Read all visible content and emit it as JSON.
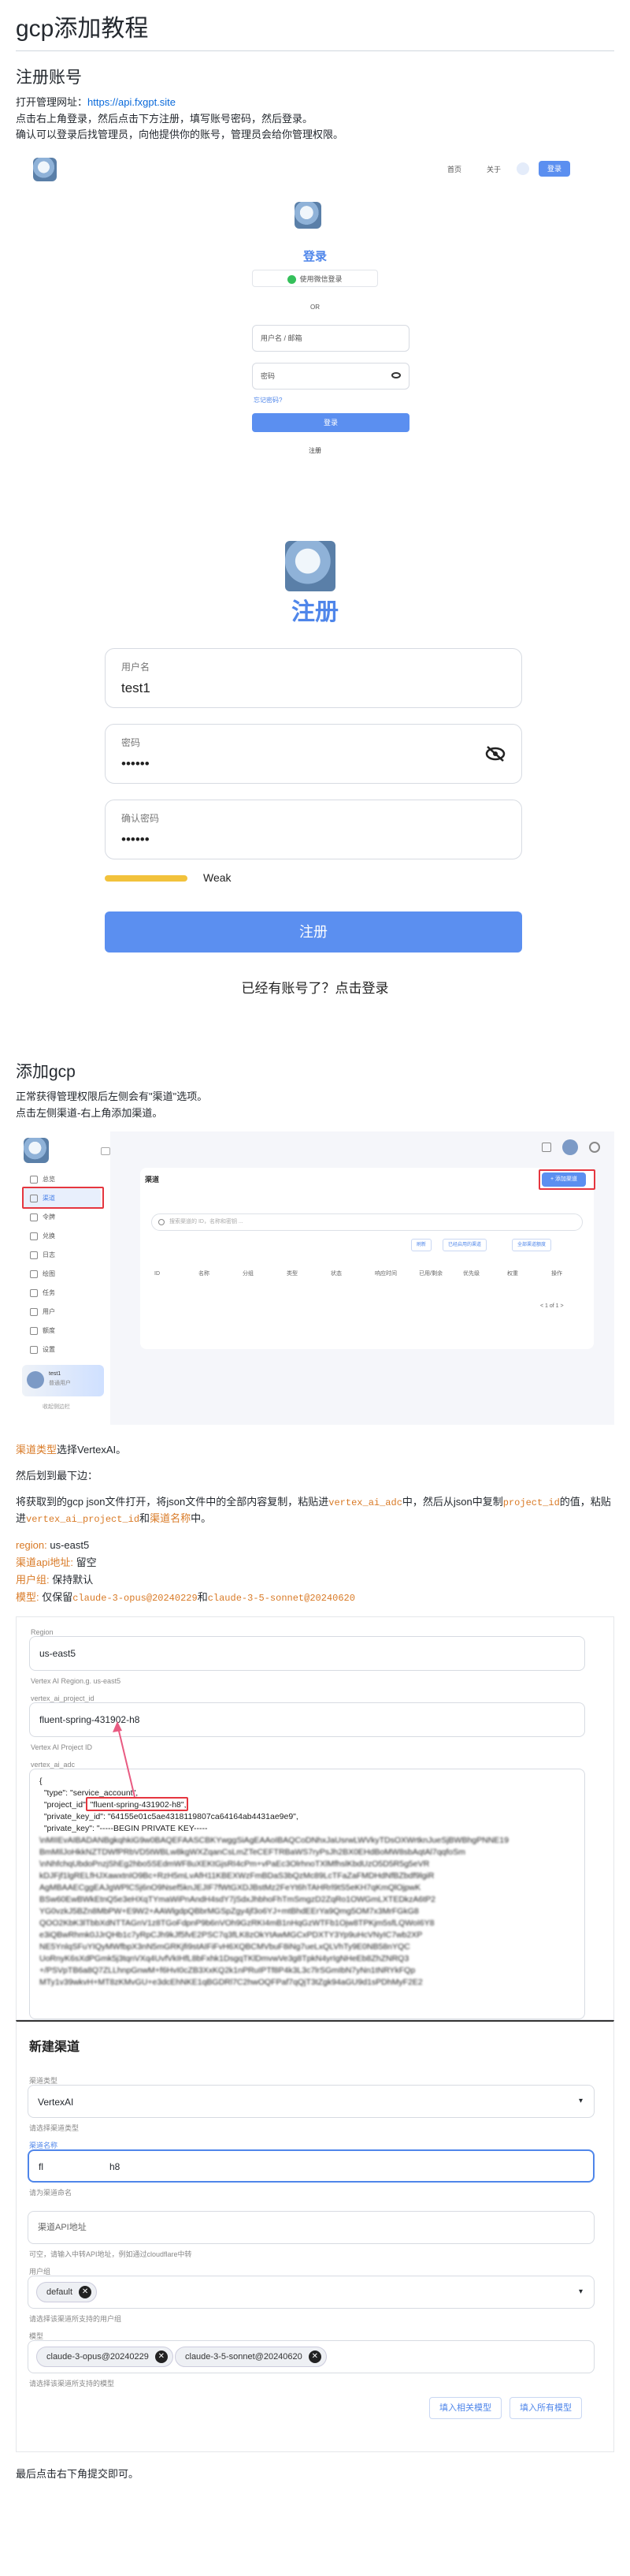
{
  "doc": {
    "title": "gcp添加教程",
    "section_register": "注册账号",
    "intro_prefix": "打开管理网址：",
    "intro_url": "https://api.fxgpt.site",
    "intro_line2": "点击右上角登录，然后点击下方注册，填写账号密码，然后登录。",
    "intro_line3": "确认可以登录后找管理员，向他提供你的账号，管理员会给你管理权限。",
    "section_gcp": "添加gcp",
    "gcp_line1": "正常获得管理权限后左侧会有\"渠道\"选项。",
    "gcp_line2": "点击左侧渠道-右上角添加渠道。",
    "type_prefix": "渠道类型",
    "type_suffix": "选择VertexAI。",
    "step_fill": "然后划到最下边：",
    "json_p1": "将获取到的gcp json文件打开，将json文件中的全部内容复制，粘贴进",
    "json_code1": "vertex_ai_adc",
    "json_p2": "中，然后从json中复制",
    "json_code2": "project_id",
    "json_p3": "的值，粘贴进",
    "json_code3": "vertex_ai_project_id",
    "json_p4": "和",
    "json_p4b": "渠道名称",
    "json_p5": "中。",
    "kv_region_k": "region:",
    "kv_region_v": " us-east5",
    "kv_api_k": "渠道api地址:",
    "kv_api_v": " 留空",
    "kv_group_k": "用户组:",
    "kv_group_v": " 保持默认",
    "kv_model_k": "模型:",
    "kv_model_v1": " 仅保留",
    "kv_model_c1": "claude-3-opus@20240229",
    "kv_model_and": "和",
    "kv_model_c2": "claude-3-5-sonnet@20240620",
    "final": "最后点击右下角提交即可。"
  },
  "shot_login": {
    "nav_home": "首页",
    "nav_about": "关于",
    "nav_login": "登录",
    "title": "登录",
    "wechat": "使用微信登录",
    "or": "OR",
    "username_ph": "用户名 / 邮箱",
    "password_ph": "密码",
    "forgot": "忘记密码?",
    "login_btn": "登录",
    "register": "注册"
  },
  "shot_register": {
    "title": "注册",
    "username_label": "用户名",
    "username_value": "test1",
    "password_label": "密码",
    "password_value": "••••••",
    "confirm_label": "确认密码",
    "confirm_value": "••••••",
    "strength": "Weak",
    "submit": "注册",
    "have_account": "已经有账号了？点击登录"
  },
  "shot_channels": {
    "menu": [
      "总览",
      "渠道",
      "令牌",
      "兑换",
      "日志",
      "绘图",
      "任务",
      "用户",
      "额度",
      "设置"
    ],
    "page_title": "渠道",
    "add_btn": "+ 添加渠道",
    "search_ph": "搜索渠道的 ID，名称和密钥 ...",
    "toolbar": [
      "刷新",
      "已经启用的渠道",
      "全部渠道额度"
    ],
    "columns": [
      "ID",
      "名称",
      "分组",
      "类型",
      "状态",
      "响应时间",
      "已用/剩余",
      "优先级",
      "权重",
      "操作"
    ],
    "pager": "< 1 of 1 >",
    "user_name": "test1",
    "user_role": "普通用户",
    "collapse": "收起侧边栏"
  },
  "shot_json": {
    "region_label": "Region",
    "region_value": "us-east5",
    "region_hint": "Vertex AI Region.g. us-east5",
    "pid_label": "vertex_ai_project_id",
    "pid_value": "fluent-spring-431902-h8",
    "pid_hint": "Vertex AI Project ID",
    "adc_label": "vertex_ai_adc",
    "json_lines": [
      "{",
      "  \"type\": \"service_account\",",
      "  \"project_id\": \"fluent-spring-431902-h8\",",
      "  \"private_key_id\": \"64155e01c5ae4318119807ca64164ab4431ae9e9\",",
      "  \"private_key\": \"-----BEGIN PRIVATE KEY-----",
      "\\nMIIEvAIBADANBgkqhkiG9w0BAQEFAASCBKYwggSiAgEAAoIBAQCoDNhxJaUsrwLWVkyTDsOXWrtknJueSjBWBhgPNNE19",
      "BmMIlJoHkkNZTDWfPRbVD5tWBLw8kgWXZqanCsLmZTeCEFTRBaWS7ryPsJh2BX0EHdBoMW8sbAqtAl7qqfoSm",
      "\\nNhfchqUbdoPnzjShEg2hbo5SEdmWF8uXEKtGjsRI4cPm+vPaEc3OlrhnoTXlMfhslKbdUzO5D5R5g5eVR",
      "kDJFjf1lgRELfHJXawxtnIO9Bc+RzH5mLvAfH11KBEXWzFmBDaS3bQzMc89LcTFaZaFMDHdNfBZbdf9lgiR",
      "AgMBAAECggEAJgWPlCSj6nO9Nsef5knJEJIF7fWtGXDJBstMz2FeYt6hTAHRrl9tS5eKH7qKmQlOjpwK",
      "BSw60EwBWkEtnQ5e3eHXqTYmaWiPnAndH4sdY7jSdxJhbhoFhTmSmgzD2ZqRo1OWGmLXTEDkzA6tP2",
      "YG0vzkJ5BZn8MbPW+E9W2+AAWlgdpQBbrMGSpZgy4jf3o6YJ+mtBhdEErYa9Qmg5OM7x3MrFGkG8",
      "QOO2KbK3lTbbXdNTTAGnV1z8TGoFdpnP9b6nVOh9GzRKI4mB1nHqGzWTFb1Ojw8TPKjm5sfLQWoI6Y8",
      "e3iQBwRhmk0JJrQHb1c7yRpCJh9kJf5fvE2PSC7q3fLK8zOkYtAwMGCxPDXTY3Yp9uHcVNyIC7wb2XP",
      "NE5YnlqSFuYIQyMWfbpX3nN5mGRKjfi9stAIFiFvH6XQBCMVbuF8iNg7ueLxQLVhTy9E0NB58nYQC",
      "UoRnyK6sXdPGmk5j3tqnVXq4UvfVkIHfL8bFxhk1DsgqTKlDmvwVe3g8TpkN4yrIgNHeEb8ZhZNRQ3",
      "+/PSVpTB6a8Q7ZLLhnpGnwM+f6HvI0cZB3XxKQ2k1nPRuIPTf8P4k3L3c7lrSGmIbN7yNn1tNRYkFQp",
      "MTy1v39wkvH+MT8zKMvGU+e3dcEhNKE1qBGDRl7C2hwOQFPaf7qQjT3tZgk94aGU9d1sPDhMyF2E2"
    ]
  },
  "shot_new_channel": {
    "title": "新建渠道",
    "type_label": "渠道类型",
    "type_value": "VertexAI",
    "type_hint": "请选择渠道类型",
    "name_label": "渠道名称",
    "name_value": "fl       h8",
    "name_hint": "请为渠道命名",
    "api_ph": "渠道API地址",
    "api_hint": "可空，请输入中转API地址，例如通过cloudflare中转",
    "group_label": "用户组",
    "group_chip": "default",
    "group_hint": "请选择该渠道所支持的用户组",
    "model_label": "模型",
    "model_chips": [
      "claude-3-opus@20240229",
      "claude-3-5-sonnet@20240620"
    ],
    "model_hint": "请选择该渠道所支持的模型",
    "btn_fill_related": "填入相关模型",
    "btn_fill_all": "填入所有模型"
  }
}
